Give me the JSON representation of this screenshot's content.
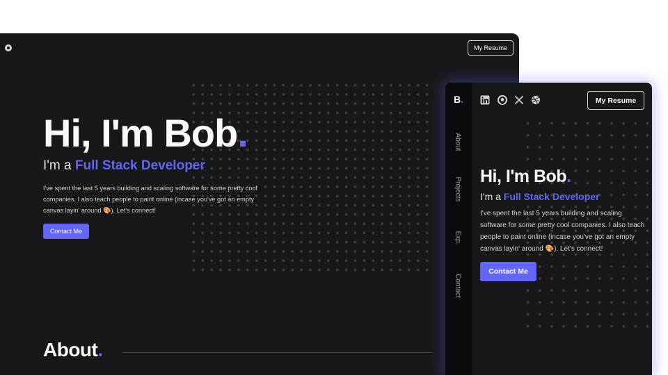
{
  "back_window": {
    "resume_label": "My Resume",
    "hero": {
      "greeting": "Hi, I'm Bob",
      "period": ".",
      "subtitle_prefix": "I'm a ",
      "role": "Full Stack Developer",
      "description": "I've spent the last 5 years building and scaling software for some pretty cool companies. I also teach people to paint online (incase you've got an empty canvas layin' around 🎨). Let's connect!",
      "contact_label": "Contact Me"
    },
    "about_heading": "About",
    "about_period": "."
  },
  "front_window": {
    "logo": "B",
    "logo_period": ".",
    "nav_items": [
      "About",
      "Projects",
      "Exp.",
      "Contact"
    ],
    "socials": [
      "linkedin-icon",
      "github-icon",
      "x-icon",
      "dribbble-icon"
    ],
    "resume_label": "My Resume",
    "hero": {
      "greeting": "Hi, I'm Bob",
      "period": ".",
      "subtitle_prefix": "I'm a ",
      "role": "Full Stack Developer",
      "description": "I've spent the last 5 years building and scaling software for some pretty cool companies. I also teach people to paint online (incase you've got an empty canvas layin' around 🎨). Let's connect!",
      "contact_label": "Contact Me"
    }
  },
  "colors": {
    "background": "#18181b",
    "sidebar": "#0b0b0d",
    "accent": "#6366f1",
    "text": "#fafafa"
  }
}
